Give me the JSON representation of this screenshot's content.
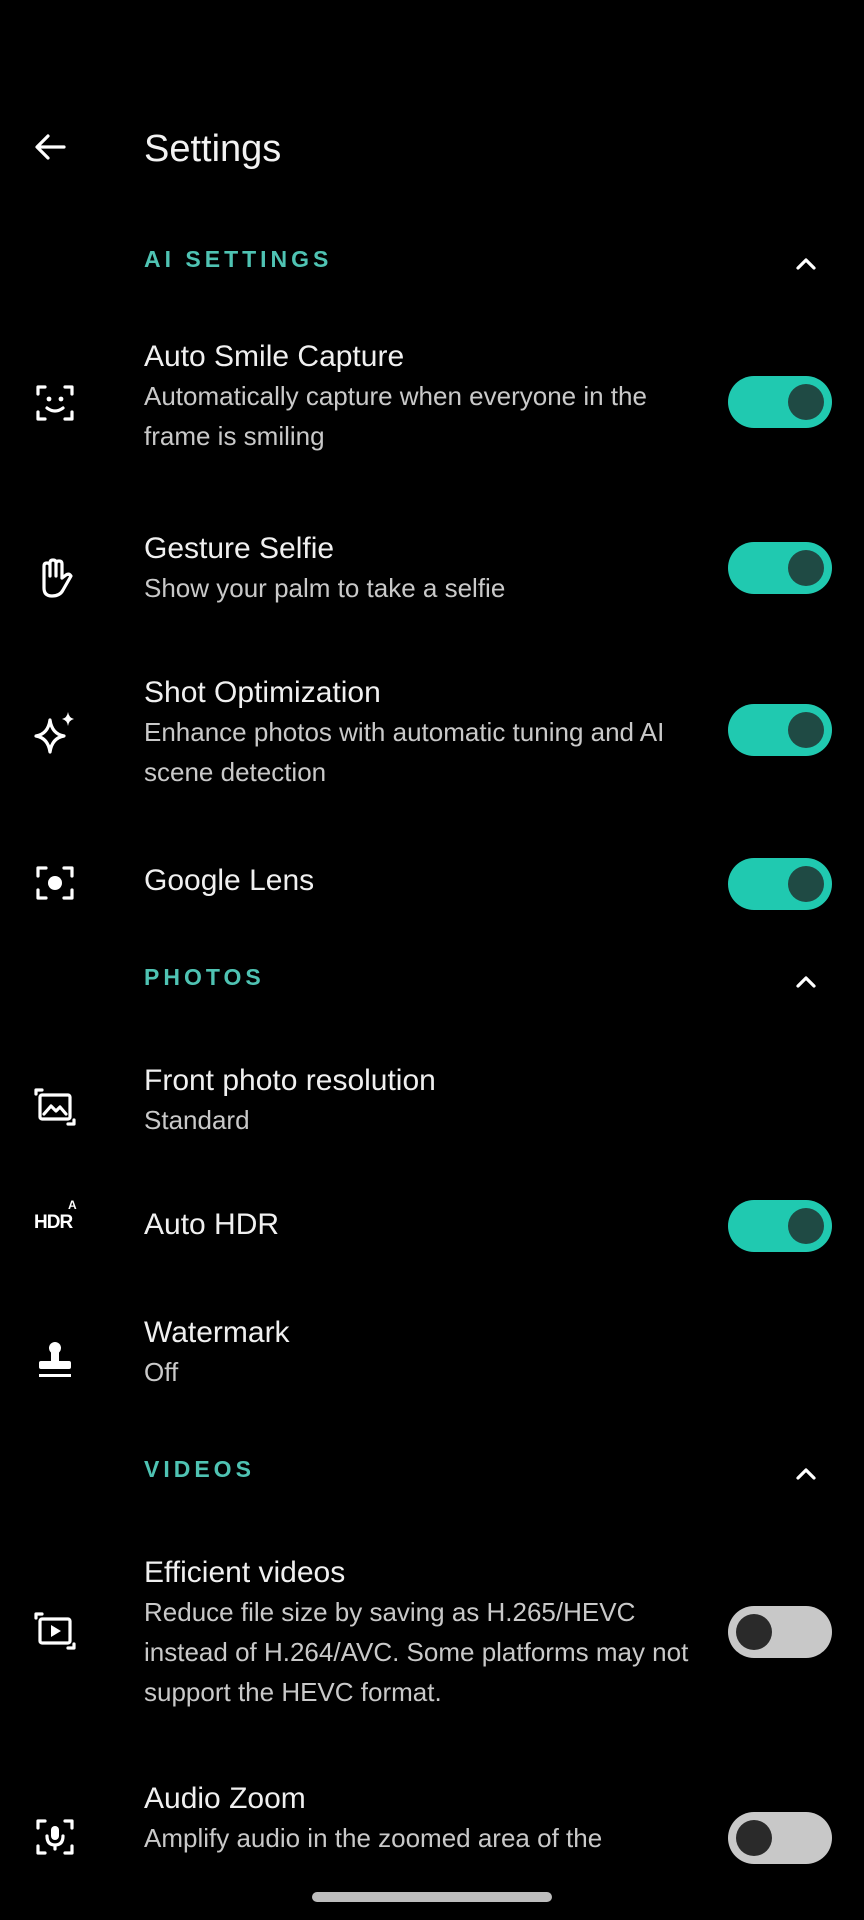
{
  "header": {
    "title": "Settings"
  },
  "sections": [
    {
      "label": "AI SETTINGS",
      "items": [
        {
          "icon": "face-frame-icon",
          "title": "Auto Smile Capture",
          "description": "Automatically capture when everyone in the frame is smiling",
          "toggle": "on"
        },
        {
          "icon": "palm-icon",
          "title": "Gesture Selfie",
          "description": "Show your palm to take a selfie",
          "toggle": "on"
        },
        {
          "icon": "sparkle-icon",
          "title": "Shot Optimization",
          "description": "Enhance photos with automatic tuning and AI scene detection",
          "toggle": "on"
        },
        {
          "icon": "lens-icon",
          "title": "Google Lens",
          "toggle": "on"
        }
      ]
    },
    {
      "label": "PHOTOS",
      "items": [
        {
          "icon": "photo-frame-icon",
          "title": "Front photo resolution",
          "value": "Standard"
        },
        {
          "icon": "hdr-icon",
          "icon_text": "HDR",
          "icon_superscript": "A",
          "title": "Auto HDR",
          "toggle": "on"
        },
        {
          "icon": "stamp-icon",
          "title": "Watermark",
          "value": "Off"
        }
      ]
    },
    {
      "label": "VIDEOS",
      "items": [
        {
          "icon": "video-frame-icon",
          "title": "Efficient videos",
          "description": "Reduce file size by saving as H.265/HEVC instead of H.264/AVC. Some platforms may not support the HEVC format.",
          "toggle": "off"
        },
        {
          "icon": "mic-frame-icon",
          "title": "Audio Zoom",
          "description": "Amplify audio in the zoomed area of the",
          "toggle": "off"
        }
      ]
    }
  ],
  "colors": {
    "accent": "#4fc3b3",
    "toggle_on": "#20c9b0",
    "toggle_off": "#c8c8c8",
    "background": "#000000"
  }
}
